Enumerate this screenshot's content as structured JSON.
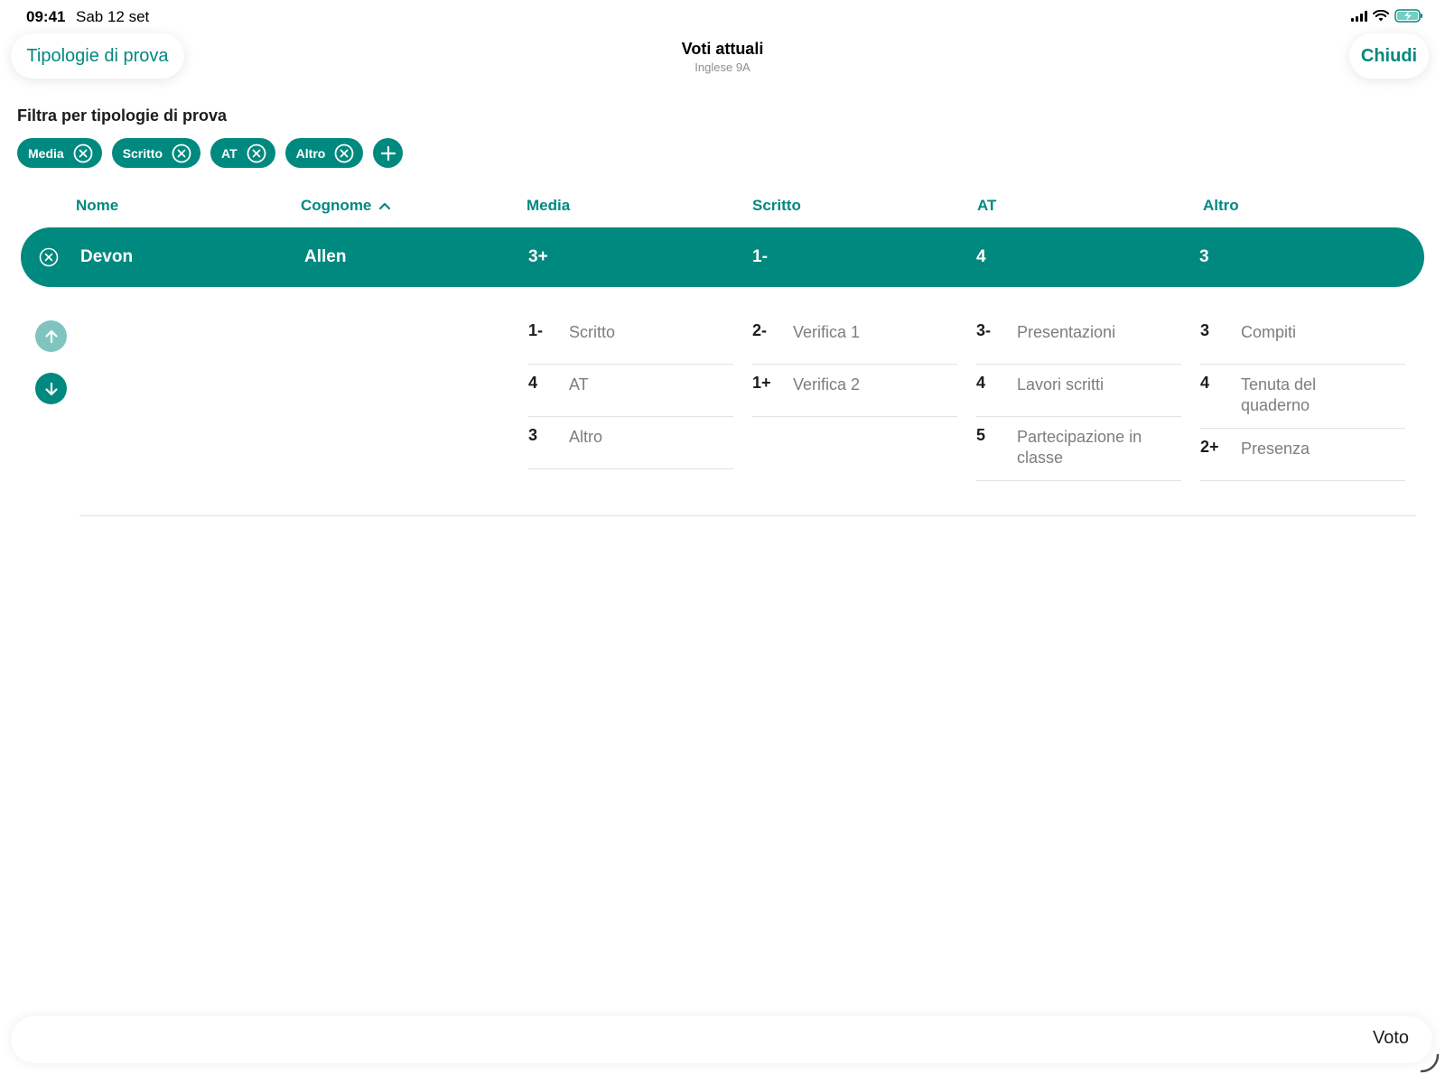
{
  "status_bar": {
    "time": "09:41",
    "date": "Sab 12 set"
  },
  "nav": {
    "left_button": "Tipologie di prova",
    "title": "Voti attuali",
    "subtitle": "Inglese 9A",
    "right_button": "Chiudi"
  },
  "filter": {
    "heading": "Filtra per tipologie di prova",
    "chips": [
      "Media",
      "Scritto",
      "AT",
      "Altro"
    ]
  },
  "columns": {
    "nome": "Nome",
    "cognome": "Cognome",
    "media": "Media",
    "scritto": "Scritto",
    "at": "AT",
    "altro": "Altro"
  },
  "student": {
    "nome": "Devon",
    "cognome": "Allen",
    "media": "3+",
    "scritto": "1-",
    "at": "4",
    "altro": "3"
  },
  "details": {
    "media": [
      {
        "grade": "1-",
        "label": "Scritto"
      },
      {
        "grade": "4",
        "label": "AT"
      },
      {
        "grade": "3",
        "label": "Altro"
      }
    ],
    "scritto": [
      {
        "grade": "2-",
        "label": "Verifica 1"
      },
      {
        "grade": "1+",
        "label": "Verifica 2"
      }
    ],
    "at": [
      {
        "grade": "3-",
        "label": "Presentazioni"
      },
      {
        "grade": "4",
        "label": "Lavori scritti"
      },
      {
        "grade": "5",
        "label": "Partecipazione in classe"
      }
    ],
    "altro": [
      {
        "grade": "3",
        "label": "Compiti"
      },
      {
        "grade": "4",
        "label": "Tenuta del quaderno"
      },
      {
        "grade": "2+",
        "label": "Presenza"
      }
    ]
  },
  "bottom_bar": {
    "label": "Voto"
  },
  "colors": {
    "accent": "#00897f",
    "accent_light": "#80c4bf"
  }
}
